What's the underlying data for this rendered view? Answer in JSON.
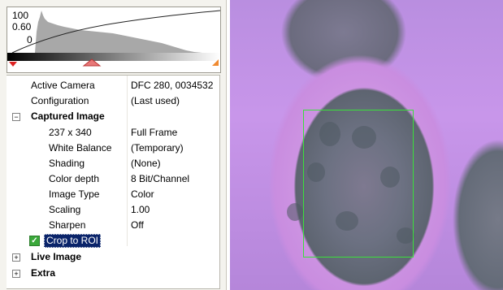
{
  "histogram": {
    "label_max": "100",
    "label_gamma": "0.60",
    "label_min": "0"
  },
  "properties": [
    {
      "label": "Active Camera",
      "value": "DFC 280, 0034532"
    },
    {
      "label": "Configuration",
      "value": "(Last used)"
    }
  ],
  "captured_image": {
    "header": "Captured Image",
    "expanded": true,
    "rows": [
      {
        "label": "237 x 340",
        "value": "Full Frame"
      },
      {
        "label": "White Balance",
        "value": "(Temporary)"
      },
      {
        "label": "Shading",
        "value": "(None)"
      },
      {
        "label": "Color depth",
        "value": "8 Bit/Channel"
      },
      {
        "label": "Image Type",
        "value": "Color"
      },
      {
        "label": "Scaling",
        "value": "1.00"
      },
      {
        "label": "Sharpen",
        "value": "Off"
      }
    ],
    "crop_label": "Crop to ROI",
    "crop_checked": true
  },
  "groups": [
    {
      "label": "Live Image",
      "expanded": false
    },
    {
      "label": "Extra",
      "expanded": false
    }
  ],
  "colors": {
    "roi": "#3be03b",
    "selection": "#0a246a"
  }
}
